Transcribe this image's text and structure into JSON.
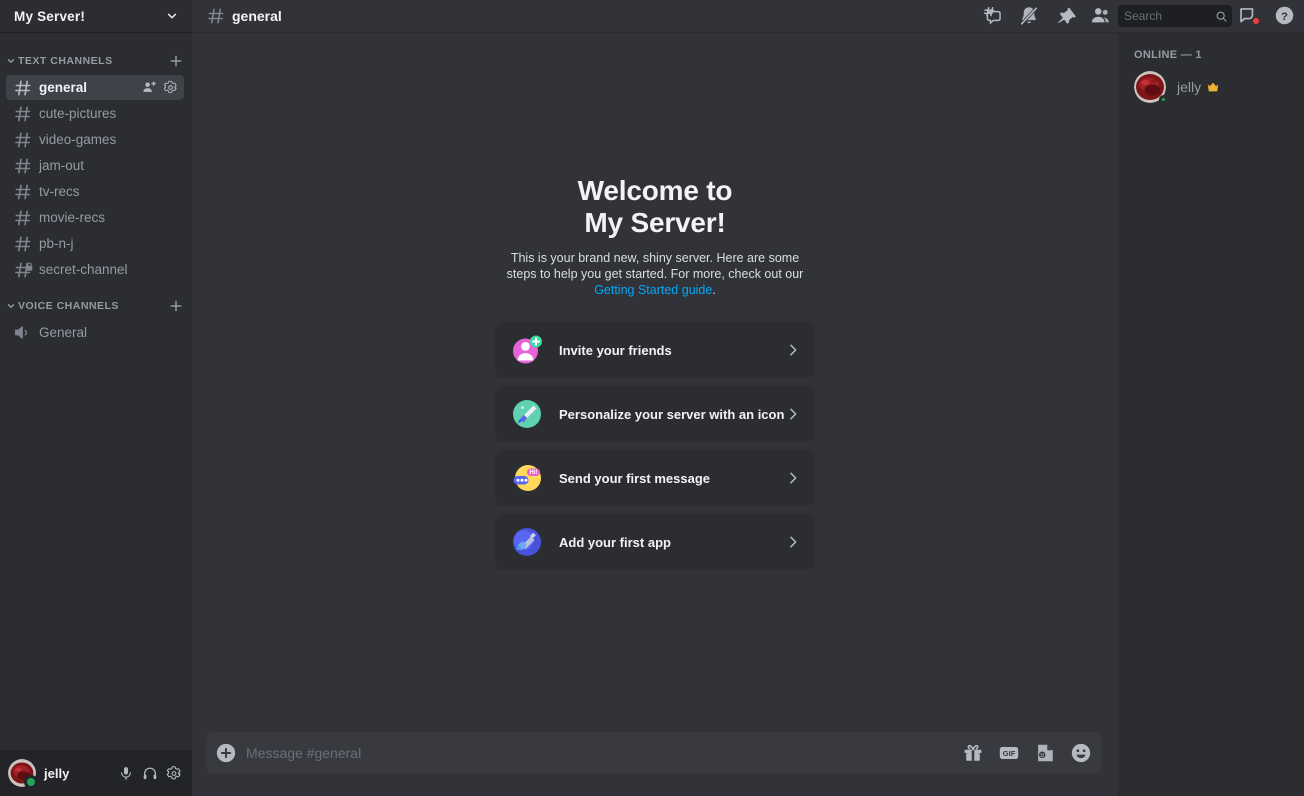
{
  "server": {
    "name": "My Server!",
    "dropdown_icon": "chevron-down-icon"
  },
  "sidebar": {
    "text_category": {
      "label": "TEXT CHANNELS",
      "add_icon": "plus-icon",
      "collapse_icon": "chevron-down-icon"
    },
    "text_channels": [
      {
        "name": "general",
        "icon": "hash-icon",
        "active": true,
        "locked": false
      },
      {
        "name": "cute-pictures",
        "icon": "hash-icon",
        "active": false,
        "locked": false
      },
      {
        "name": "video-games",
        "icon": "hash-icon",
        "active": false,
        "locked": false
      },
      {
        "name": "jam-out",
        "icon": "hash-icon",
        "active": false,
        "locked": false
      },
      {
        "name": "tv-recs",
        "icon": "hash-icon",
        "active": false,
        "locked": false
      },
      {
        "name": "movie-recs",
        "icon": "hash-icon",
        "active": false,
        "locked": false
      },
      {
        "name": "pb-n-j",
        "icon": "hash-icon",
        "active": false,
        "locked": false
      },
      {
        "name": "secret-channel",
        "icon": "hash-lock-icon",
        "active": false,
        "locked": true
      }
    ],
    "active_channel_actions": {
      "invite_icon": "create-invite-icon",
      "settings_icon": "gear-icon"
    },
    "voice_category": {
      "label": "VOICE CHANNELS",
      "add_icon": "plus-icon",
      "collapse_icon": "chevron-down-icon"
    },
    "voice_channels": [
      {
        "name": "General",
        "icon": "speaker-icon"
      }
    ]
  },
  "user_panel": {
    "username": "jelly",
    "status": "online",
    "mic_icon": "microphone-icon",
    "headset_icon": "headphones-icon",
    "settings_icon": "gear-icon"
  },
  "topbar": {
    "channel_icon": "hash-icon",
    "channel_name": "general",
    "icons": [
      {
        "name": "threads-icon",
        "label": "Threads"
      },
      {
        "name": "bell-off-icon",
        "label": "Notification Settings"
      },
      {
        "name": "pin-icon",
        "label": "Pinned Messages"
      },
      {
        "name": "members-icon",
        "label": "Member List"
      }
    ],
    "search": {
      "placeholder": "Search",
      "value": "",
      "icon": "search-icon"
    },
    "inbox_icon": "inbox-icon",
    "inbox_badge": true,
    "help_icon": "help-circle-icon"
  },
  "welcome": {
    "title_line1": "Welcome to",
    "title_line2": "My Server!",
    "description_part1": "This is your brand new, shiny server. Here are some steps to help you get started. For more, check out our ",
    "link_text": "Getting Started guide",
    "description_part2": ".",
    "cards": [
      {
        "label": "Invite your friends",
        "icon": "invite-friends-icon",
        "chevron": "chevron-right-icon"
      },
      {
        "label": "Personalize your server with an icon",
        "icon": "personalize-icon",
        "chevron": "chevron-right-icon"
      },
      {
        "label": "Send your first message",
        "icon": "first-message-icon",
        "chevron": "chevron-right-icon"
      },
      {
        "label": "Add your first app",
        "icon": "first-app-icon",
        "chevron": "chevron-right-icon"
      }
    ]
  },
  "composer": {
    "placeholder": "Message #general",
    "value": "",
    "add_icon": "plus-circle-icon",
    "icons": [
      {
        "name": "gift-icon",
        "label": "Gift"
      },
      {
        "name": "gif-icon",
        "label": "GIF"
      },
      {
        "name": "sticker-icon",
        "label": "Sticker"
      },
      {
        "name": "emoji-icon",
        "label": "Emoji"
      }
    ]
  },
  "members": {
    "header": "ONLINE — 1",
    "list": [
      {
        "name": "jelly",
        "status": "online",
        "badge": "crown-icon"
      }
    ]
  },
  "colors": {
    "sidebar_bg": "#2b2d31",
    "chat_bg": "#313338",
    "user_panel_bg": "#232428",
    "active_channel_bg": "#404249",
    "card_bg": "#2b2d31",
    "composer_bg": "#383a40",
    "link": "#00a8fc",
    "online": "#23a55a",
    "badge_red": "#f23f43",
    "text_muted": "#949ba4",
    "text_bright": "#f2f3f5"
  }
}
